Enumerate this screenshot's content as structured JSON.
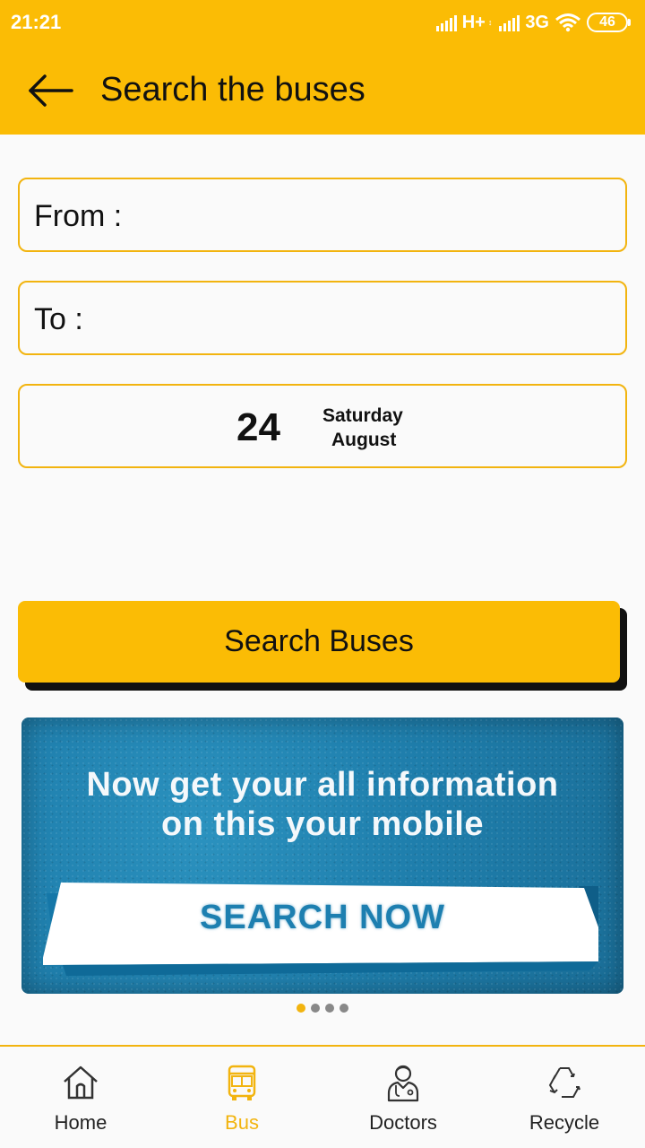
{
  "status_bar": {
    "time": "21:21",
    "network_1": "H+",
    "network_1_sub": "↕",
    "network_2": "3G",
    "battery": "46"
  },
  "app_bar": {
    "title": "Search the buses",
    "back_icon": "arrow-left-icon"
  },
  "form": {
    "from_label": "From :",
    "from_value": "",
    "to_label": "To :",
    "to_value": "",
    "date": {
      "day": "24",
      "weekday": "Saturday",
      "month": "August"
    }
  },
  "search_button": {
    "label": "Search Buses"
  },
  "banner": {
    "line1": "Now get your all information",
    "line2": "on this your mobile",
    "cta": "SEARCH NOW"
  },
  "carousel": {
    "count": 4,
    "active_index": 0
  },
  "bottom_nav": {
    "items": [
      {
        "label": "Home",
        "icon": "home-icon",
        "active": false
      },
      {
        "label": "Bus",
        "icon": "bus-icon",
        "active": true
      },
      {
        "label": "Doctors",
        "icon": "doctor-icon",
        "active": false
      },
      {
        "label": "Recycle",
        "icon": "recycle-icon",
        "active": false
      }
    ]
  },
  "colors": {
    "accent": "#fbbc05",
    "border": "#f2b40f",
    "banner_blue": "#1f7fad"
  }
}
